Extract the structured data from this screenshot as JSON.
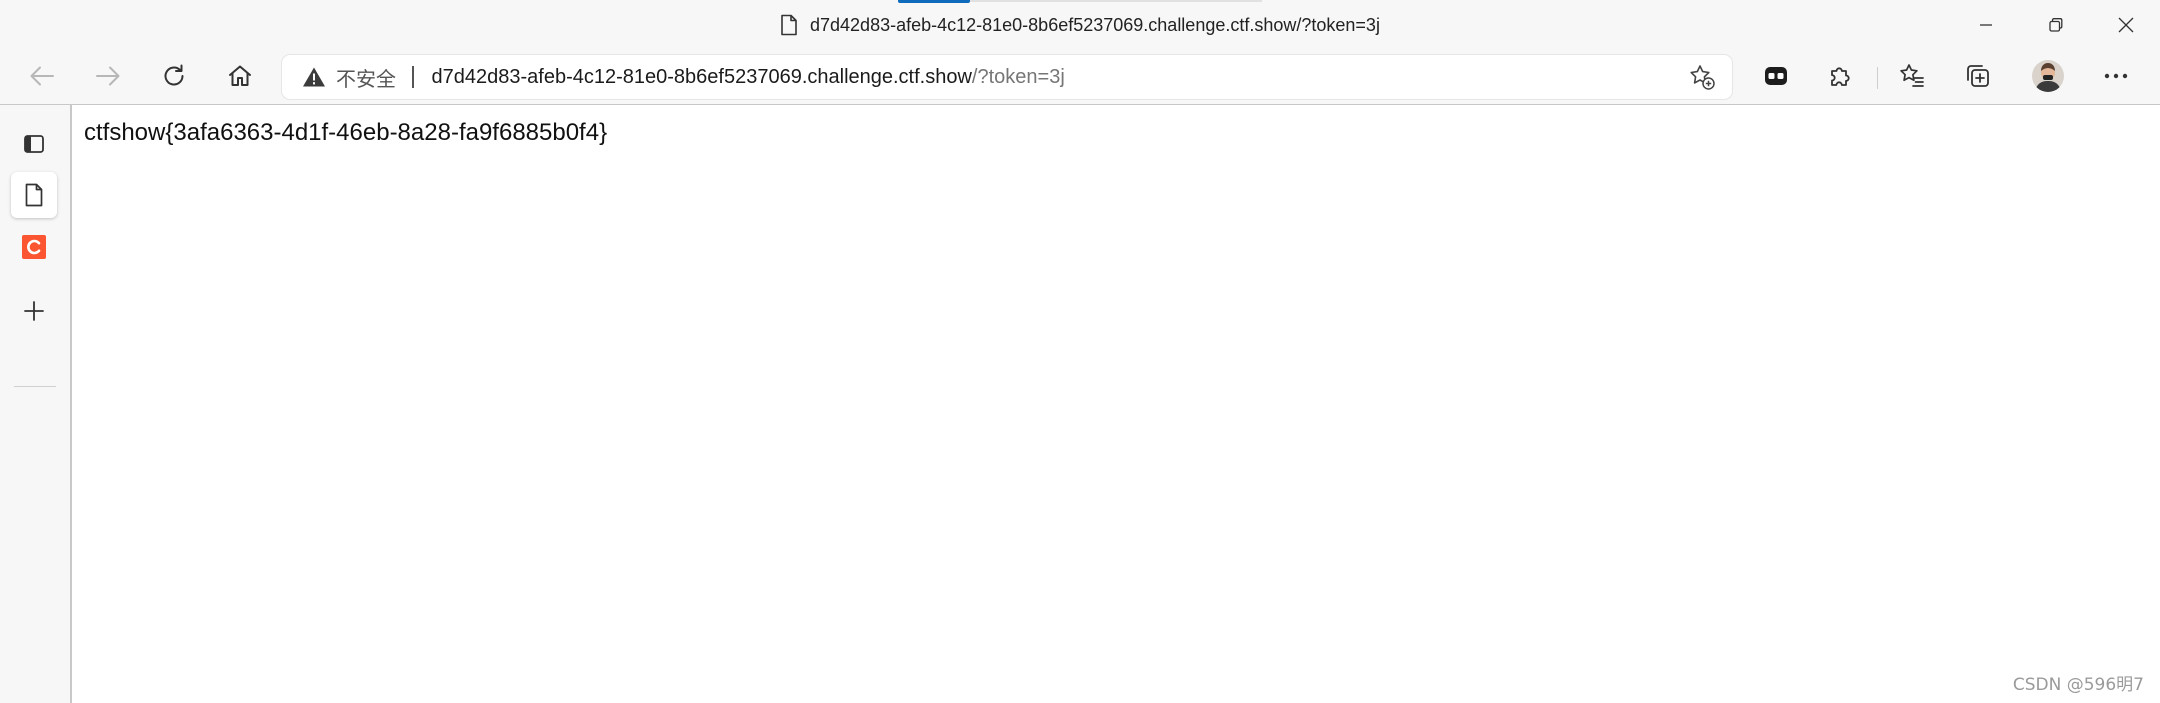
{
  "window": {
    "title": "d7d42d83-afeb-4c12-81e0-8b6ef5237069.challenge.ctf.show/?token=3j"
  },
  "toolbar": {
    "back_label": "Back",
    "forward_label": "Forward",
    "refresh_label": "Refresh",
    "home_label": "Home"
  },
  "address": {
    "security_text": "不安全",
    "host": "d7d42d83-afeb-4c12-81e0-8b6ef5237069.challenge.ctf.show",
    "path": "/?token=3j"
  },
  "sidebar": {
    "items": [
      {
        "icon": "tab-actions-icon"
      },
      {
        "icon": "page-icon",
        "active": true
      },
      {
        "icon": "csdn-c-icon",
        "color": "#fc5531"
      },
      {
        "icon": "add-icon"
      }
    ]
  },
  "page": {
    "content": "ctfshow{3afa6363-4d1f-46eb-8a28-fa9f6885b0f4}"
  },
  "watermark": "CSDN @596明7",
  "colors": {
    "accent": "#0f6cbd",
    "csdn": "#fc5531",
    "chrome_bg": "#f7f7f7"
  }
}
